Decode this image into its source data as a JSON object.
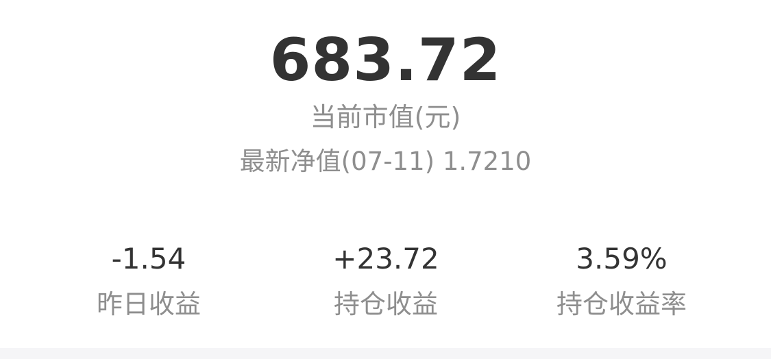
{
  "summary": {
    "market_value": "683.72",
    "market_value_label": "当前市值(元)",
    "nav_label": "最新净值(07-11)",
    "nav_value": "1.7210"
  },
  "stats": [
    {
      "value": "-1.54",
      "label": "昨日收益"
    },
    {
      "value": "+23.72",
      "label": "持仓收益"
    },
    {
      "value": "3.59%",
      "label": "持仓收益率"
    }
  ],
  "colors": {
    "primary_text": "#333333",
    "secondary_text": "#8e8e8e",
    "bottom_band": "#f5f5f7"
  }
}
